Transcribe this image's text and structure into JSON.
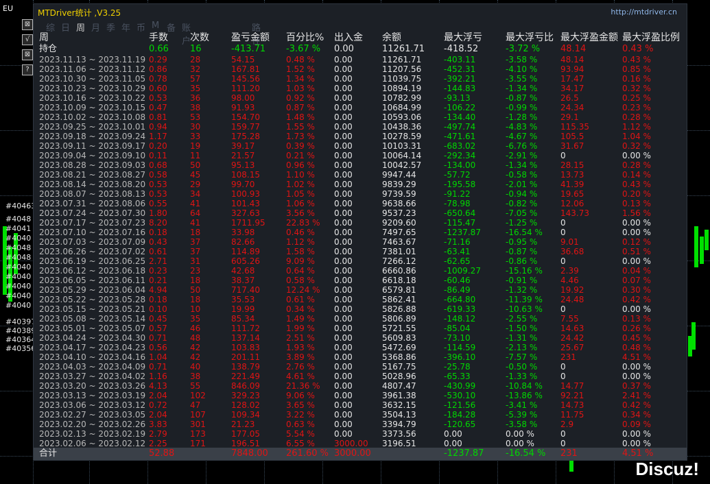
{
  "chart": {
    "symbol": "EU",
    "side_buttons": [
      "⊠",
      "√",
      "⊠",
      "?"
    ],
    "order_labels": [
      "#40463",
      "#4048",
      "#4041",
      "#4040",
      "#4048",
      "#4048",
      "#4040",
      "#4040",
      "#4040",
      "#4040",
      "#4040",
      "#40397",
      "#40389",
      "#40364",
      "#40356"
    ],
    "watermark": "Discuz!"
  },
  "panel": {
    "title": "MTDriver统计 ,V3.25",
    "url": "http://mtdriver.cn",
    "tabs": [
      "综",
      "日",
      "周",
      "月",
      "季",
      "年",
      "币",
      "M",
      "备",
      "账户",
      "路径"
    ],
    "active_tab": "周"
  },
  "table": {
    "headers": [
      "周",
      "手数",
      "次数",
      "盈亏金额",
      "百分比%",
      "出入金",
      "余额",
      "最大浮亏",
      "最大浮亏比",
      "最大浮盈金额",
      "最大浮盈比例"
    ],
    "holding": {
      "label": "持仓",
      "lots": "0.66",
      "count": "16",
      "pl": "-413.71",
      "pct": "-3.67 %",
      "io": "0.00",
      "bal": "11261.71",
      "maxfl": "-418.52",
      "maxflp": "-3.72 %",
      "maxfp": "48.14",
      "maxfpp": "0.43 %"
    },
    "rows": [
      [
        "2023.11.13 ~ 2023.11.19",
        "0.29",
        "28",
        "54.15",
        "0.48 %",
        "0.00",
        "11261.71",
        "-403.11",
        "-3.58 %",
        "48.14",
        "0.43 %"
      ],
      [
        "2023.11.06 ~ 2023.11.12",
        "0.86",
        "32",
        "167.81",
        "1.52 %",
        "0.00",
        "11207.56",
        "-452.31",
        "-4.10 %",
        "93.94",
        "0.85 %"
      ],
      [
        "2023.10.30 ~ 2023.11.05",
        "0.78",
        "57",
        "145.56",
        "1.34 %",
        "0.00",
        "11039.75",
        "-392.21",
        "-3.55 %",
        "17.47",
        "0.16 %"
      ],
      [
        "2023.10.23 ~ 2023.10.29",
        "0.60",
        "35",
        "111.20",
        "1.03 %",
        "0.00",
        "10894.19",
        "-144.83",
        "-1.34 %",
        "34.17",
        "0.32 %"
      ],
      [
        "2023.10.16 ~ 2023.10.22",
        "0.53",
        "36",
        "98.00",
        "0.92 %",
        "0.00",
        "10782.99",
        "-93.13",
        "-0.87 %",
        "26.5",
        "0.25 %"
      ],
      [
        "2023.10.09 ~ 2023.10.15",
        "0.47",
        "38",
        "91.93",
        "0.87 %",
        "0.00",
        "10684.99",
        "-106.22",
        "-0.99 %",
        "24.34",
        "0.23 %"
      ],
      [
        "2023.10.02 ~ 2023.10.08",
        "0.81",
        "53",
        "154.70",
        "1.48 %",
        "0.00",
        "10593.06",
        "-134.40",
        "-1.28 %",
        "29.1",
        "0.28 %"
      ],
      [
        "2023.09.25 ~ 2023.10.01",
        "0.94",
        "30",
        "159.77",
        "1.55 %",
        "0.00",
        "10438.36",
        "-497.74",
        "-4.83 %",
        "115.35",
        "1.12 %"
      ],
      [
        "2023.09.18 ~ 2023.09.24",
        "1.17",
        "33",
        "175.28",
        "1.73 %",
        "0.00",
        "10278.59",
        "-471.61",
        "-4.67 %",
        "105.5",
        "1.04 %"
      ],
      [
        "2023.09.11 ~ 2023.09.17",
        "0.20",
        "19",
        "39.17",
        "0.39 %",
        "0.00",
        "10103.31",
        "-683.02",
        "-6.76 %",
        "31.67",
        "0.32 %"
      ],
      [
        "2023.09.04 ~ 2023.09.10",
        "0.11",
        "11",
        "21.57",
        "0.21 %",
        "0.00",
        "10064.14",
        "-292.34",
        "-2.91 %",
        "0",
        "0.00 %"
      ],
      [
        "2023.08.28 ~ 2023.09.03",
        "0.68",
        "50",
        "95.13",
        "0.96 %",
        "0.00",
        "10042.57",
        "-134.00",
        "-1.34 %",
        "28.15",
        "0.28 %"
      ],
      [
        "2023.08.21 ~ 2023.08.27",
        "0.58",
        "45",
        "108.15",
        "1.10 %",
        "0.00",
        "9947.44",
        "-57.72",
        "-0.58 %",
        "13.73",
        "0.14 %"
      ],
      [
        "2023.08.14 ~ 2023.08.20",
        "0.53",
        "29",
        "99.70",
        "1.02 %",
        "0.00",
        "9839.29",
        "-195.58",
        "-2.01 %",
        "41.39",
        "0.43 %"
      ],
      [
        "2023.08.07 ~ 2023.08.13",
        "0.53",
        "34",
        "100.93",
        "1.05 %",
        "0.00",
        "9739.59",
        "-91.22",
        "-0.94 %",
        "19.65",
        "0.20 %"
      ],
      [
        "2023.07.31 ~ 2023.08.06",
        "0.55",
        "41",
        "101.43",
        "1.06 %",
        "0.00",
        "9638.66",
        "-78.98",
        "-0.82 %",
        "12.06",
        "0.13 %"
      ],
      [
        "2023.07.24 ~ 2023.07.30",
        "1.80",
        "64",
        "327.63",
        "3.56 %",
        "0.00",
        "9537.23",
        "-650.64",
        "-7.05 %",
        "143.73",
        "1.56 %"
      ],
      [
        "2023.07.17 ~ 2023.07.23",
        "8.20",
        "41",
        "1711.95",
        "22.83 %",
        "0.00",
        "9209.60",
        "-115.47",
        "-1.25 %",
        "0",
        "0.00 %"
      ],
      [
        "2023.07.10 ~ 2023.07.16",
        "0.18",
        "18",
        "33.98",
        "0.46 %",
        "0.00",
        "7497.65",
        "-1237.87",
        "-16.54 %",
        "0",
        "0.00 %"
      ],
      [
        "2023.07.03 ~ 2023.07.09",
        "0.43",
        "37",
        "82.66",
        "1.12 %",
        "0.00",
        "7463.67",
        "-71.16",
        "-0.95 %",
        "9.01",
        "0.12 %"
      ],
      [
        "2023.06.26 ~ 2023.07.02",
        "0.61",
        "37",
        "114.89",
        "1.58 %",
        "0.00",
        "7381.01",
        "-63.41",
        "-0.87 %",
        "36.68",
        "0.51 %"
      ],
      [
        "2023.06.19 ~ 2023.06.25",
        "2.71",
        "31",
        "605.26",
        "9.09 %",
        "0.00",
        "7266.12",
        "-62.65",
        "-0.86 %",
        "0",
        "0.00 %"
      ],
      [
        "2023.06.12 ~ 2023.06.18",
        "0.23",
        "23",
        "42.68",
        "0.64 %",
        "0.00",
        "6660.86",
        "-1009.27",
        "-15.16 %",
        "2.39",
        "0.04 %"
      ],
      [
        "2023.06.05 ~ 2023.06.11",
        "0.21",
        "18",
        "38.37",
        "0.58 %",
        "0.00",
        "6618.18",
        "-60.46",
        "-0.91 %",
        "4.46",
        "0.07 %"
      ],
      [
        "2023.05.29 ~ 2023.06.04",
        "4.94",
        "50",
        "717.40",
        "12.24 %",
        "0.00",
        "6579.81",
        "-86.49",
        "-1.32 %",
        "19.92",
        "0.30 %"
      ],
      [
        "2023.05.22 ~ 2023.05.28",
        "0.18",
        "18",
        "35.53",
        "0.61 %",
        "0.00",
        "5862.41",
        "-664.80",
        "-11.39 %",
        "24.48",
        "0.42 %"
      ],
      [
        "2023.05.15 ~ 2023.05.21",
        "0.10",
        "10",
        "19.99",
        "0.34 %",
        "0.00",
        "5826.88",
        "-619.33",
        "-10.63 %",
        "0",
        "0.00 %"
      ],
      [
        "2023.05.08 ~ 2023.05.14",
        "0.45",
        "35",
        "85.34",
        "1.49 %",
        "0.00",
        "5806.89",
        "-148.12",
        "-2.55 %",
        "7.55",
        "0.13 %"
      ],
      [
        "2023.05.01 ~ 2023.05.07",
        "0.57",
        "46",
        "111.72",
        "1.99 %",
        "0.00",
        "5721.55",
        "-85.04",
        "-1.50 %",
        "14.63",
        "0.26 %"
      ],
      [
        "2023.04.24 ~ 2023.04.30",
        "0.71",
        "48",
        "137.14",
        "2.51 %",
        "0.00",
        "5609.83",
        "-73.10",
        "-1.31 %",
        "24.42",
        "0.45 %"
      ],
      [
        "2023.04.17 ~ 2023.04.23",
        "0.56",
        "42",
        "103.83",
        "1.93 %",
        "0.00",
        "5472.69",
        "-114.59",
        "-2.13 %",
        "25.67",
        "0.48 %"
      ],
      [
        "2023.04.10 ~ 2023.04.16",
        "1.04",
        "42",
        "201.11",
        "3.89 %",
        "0.00",
        "5368.86",
        "-396.10",
        "-7.57 %",
        "231",
        "4.51 %"
      ],
      [
        "2023.04.03 ~ 2023.04.09",
        "0.71",
        "40",
        "138.79",
        "2.76 %",
        "0.00",
        "5167.75",
        "-25.78",
        "-0.50 %",
        "0",
        "0.00 %"
      ],
      [
        "2023.03.27 ~ 2023.04.02",
        "1.16",
        "38",
        "221.49",
        "4.61 %",
        "0.00",
        "5028.96",
        "-65.33",
        "-1.33 %",
        "0",
        "0.00 %"
      ],
      [
        "2023.03.20 ~ 2023.03.26",
        "4.13",
        "55",
        "846.09",
        "21.36 %",
        "0.00",
        "4807.47",
        "-430.99",
        "-10.84 %",
        "14.77",
        "0.37 %"
      ],
      [
        "2023.03.13 ~ 2023.03.19",
        "2.04",
        "102",
        "329.23",
        "9.06 %",
        "0.00",
        "3961.38",
        "-530.10",
        "-13.86 %",
        "92.21",
        "2.41 %"
      ],
      [
        "2023.03.06 ~ 2023.03.12",
        "0.72",
        "47",
        "128.02",
        "3.65 %",
        "0.00",
        "3632.15",
        "-121.56",
        "-3.41 %",
        "14.73",
        "0.42 %"
      ],
      [
        "2023.02.27 ~ 2023.03.05",
        "2.04",
        "107",
        "109.34",
        "3.22 %",
        "0.00",
        "3504.13",
        "-184.28",
        "-5.39 %",
        "11.75",
        "0.34 %"
      ],
      [
        "2023.02.20 ~ 2023.02.26",
        "3.83",
        "301",
        "21.23",
        "0.63 %",
        "0.00",
        "3394.79",
        "-120.65",
        "-3.58 %",
        "2.9",
        "0.09 %"
      ],
      [
        "2023.02.13 ~ 2023.02.19",
        "2.79",
        "173",
        "177.05",
        "5.54 %",
        "0.00",
        "3373.56",
        "0.00",
        "0.00 %",
        "0",
        "0.00 %"
      ],
      [
        "2023.02.06 ~ 2023.02.12",
        "2.25",
        "171",
        "196.51",
        "6.55 %",
        "3000.00",
        "3196.51",
        "0.00",
        "0.00 %",
        "0",
        "0.00 %"
      ]
    ],
    "total": {
      "label": "合计",
      "lots": "52.88",
      "count": "",
      "pl": "7848.00",
      "pct": "261.60 %",
      "io": "3000.00",
      "bal": "",
      "maxfl": "-1237.87",
      "maxflp": "-16.54 %",
      "maxfp": "231",
      "maxfpp": "4.51 %"
    }
  }
}
